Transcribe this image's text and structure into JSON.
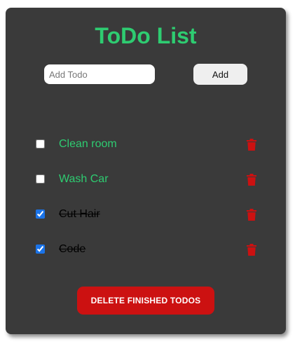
{
  "app": {
    "title": "ToDo List"
  },
  "input": {
    "placeholder": "Add Todo",
    "value": ""
  },
  "add_button": {
    "label": "Add"
  },
  "todos": [
    {
      "text": "Clean room",
      "done": false
    },
    {
      "text": "Wash Car",
      "done": false
    },
    {
      "text": "Cut Hair",
      "done": true
    },
    {
      "text": "Code",
      "done": true
    }
  ],
  "delete_finished": {
    "label": "DELETE FINISHED TODOS"
  },
  "icons": {
    "trash": "trash-icon"
  },
  "colors": {
    "card_background": "#3a3a3a",
    "accent_green": "#2ecc71",
    "danger_red": "#cc1111",
    "done_text": "#000000"
  }
}
